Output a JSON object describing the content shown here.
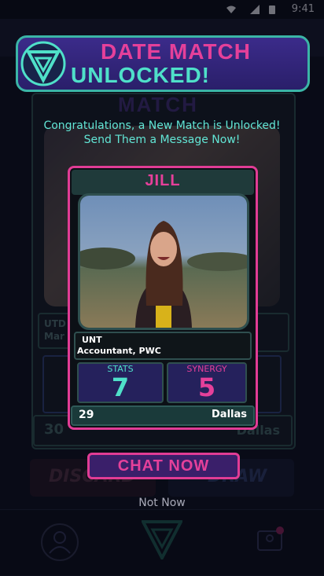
{
  "status_bar": {
    "time": "9:41"
  },
  "banner": {
    "line1": "DATE MATCH",
    "line2": "UNLOCKED!"
  },
  "message": {
    "line1": "Congratulations, a New Match is Unlocked!",
    "line2": "Send Them a Message Now!"
  },
  "card": {
    "name": "JILL",
    "school": "UNT",
    "job": "Accountant, PWC",
    "stats_label": "STATS",
    "stats_value": "7",
    "synergy_label": "SYNERGY",
    "synergy_value": "5",
    "age": "29",
    "city": "Dallas"
  },
  "background_screen": {
    "title": "MATCH",
    "info_text": "UTD\nMar",
    "age": "30",
    "city": "Dallas",
    "discard_label": "DISCARD",
    "draw_label": "DRAW"
  },
  "actions": {
    "chat_now": "CHAT NOW",
    "not_now": "Not Now"
  },
  "colors": {
    "accent_pink": "#e5409a",
    "accent_teal": "#4fe0c9",
    "banner_purple": "#3b2b8a"
  }
}
